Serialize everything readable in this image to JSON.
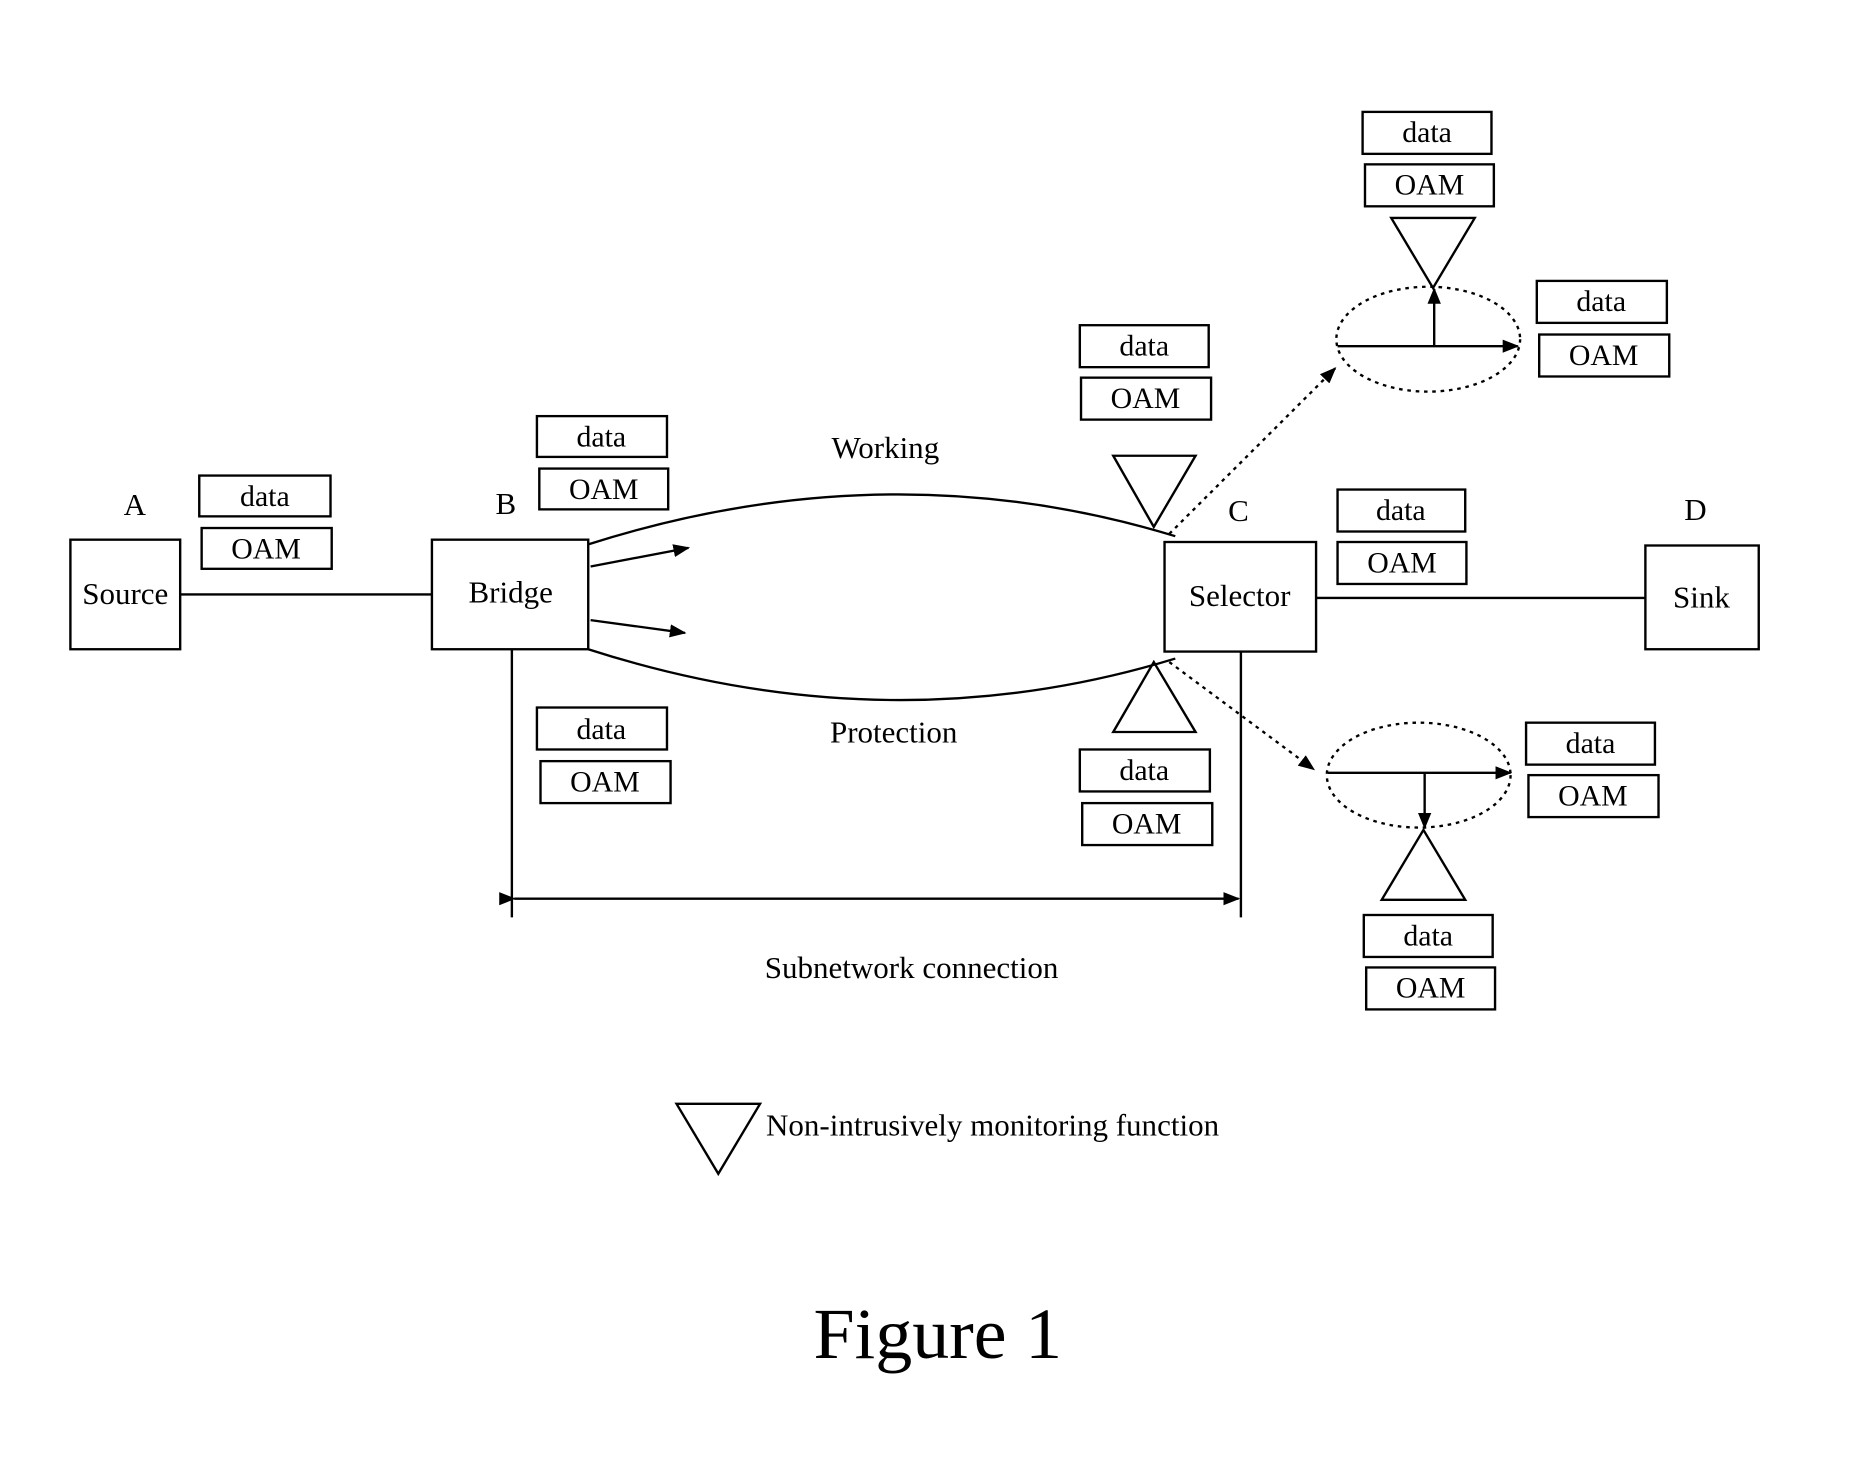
{
  "figure": {
    "title": "Figure 1",
    "legend": {
      "icon": "inverted-triangle-icon",
      "text": "Non-intrusively monitoring function"
    }
  },
  "nodes": [
    {
      "id": "A",
      "letter": "A",
      "label": "Source"
    },
    {
      "id": "B",
      "letter": "B",
      "label": "Bridge"
    },
    {
      "id": "C",
      "letter": "C",
      "label": "Selector"
    },
    {
      "id": "D",
      "letter": "D",
      "label": "Sink"
    }
  ],
  "paths": {
    "working": "Working",
    "protection": "Protection",
    "span": "Subnetwork connection"
  },
  "packet": {
    "data": "data",
    "oam": "OAM"
  },
  "packets": [
    {
      "id": "pkt-a-b",
      "data": "data",
      "oam": "OAM"
    },
    {
      "id": "pkt-b-working",
      "data": "data",
      "oam": "OAM"
    },
    {
      "id": "pkt-b-protection",
      "data": "data",
      "oam": "OAM"
    },
    {
      "id": "pkt-c-working-monitor",
      "data": "data",
      "oam": "OAM"
    },
    {
      "id": "pkt-c-protection-monitor",
      "data": "data",
      "oam": "OAM"
    },
    {
      "id": "pkt-c-d",
      "data": "data",
      "oam": "OAM"
    },
    {
      "id": "pkt-zoom-working-up",
      "data": "data",
      "oam": "OAM"
    },
    {
      "id": "pkt-zoom-working-right",
      "data": "data",
      "oam": "OAM"
    },
    {
      "id": "pkt-zoom-protection-right",
      "data": "data",
      "oam": "OAM"
    },
    {
      "id": "pkt-zoom-protection-down",
      "data": "data",
      "oam": "OAM"
    }
  ]
}
